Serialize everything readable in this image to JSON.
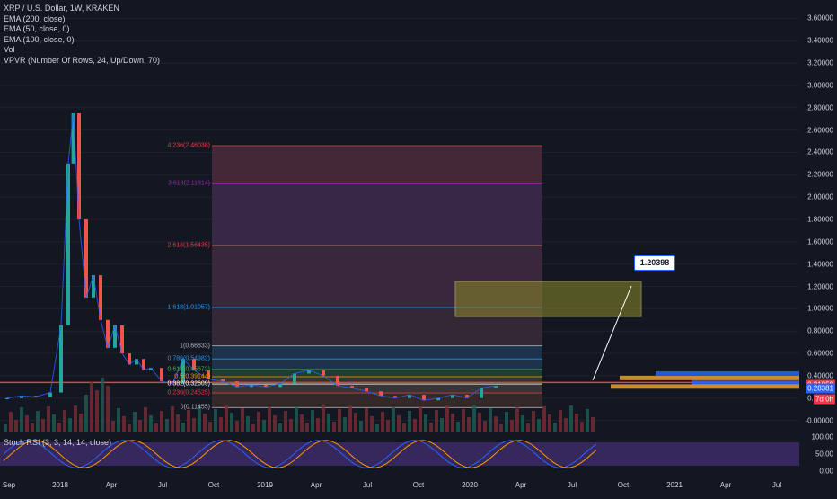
{
  "chart_data": {
    "type": "candlestick",
    "title": "XRP / U.S. Dollar, 1W, KRAKEN",
    "indicators": [
      "EMA (200, close)",
      "EMA (50, close, 0)",
      "EMA (100, close, 0)",
      "Vol",
      "VPVR (Number Of Rows, 24, Up/Down, 70)"
    ],
    "sub_indicator": "Stoch RSI (3, 3, 14, 14, close)",
    "x_ticks": [
      "Sep",
      "2018",
      "Apr",
      "Jul",
      "Oct",
      "2019",
      "Apr",
      "Jul",
      "Oct",
      "2020",
      "Apr",
      "Jul",
      "Oct",
      "2021",
      "Apr",
      "Jul"
    ],
    "y_ticks": [
      "3.60000",
      "3.40000",
      "3.20000",
      "3.00000",
      "2.80000",
      "2.60000",
      "2.40000",
      "2.20000",
      "2.00000",
      "1.80000",
      "1.60000",
      "1.40000",
      "1.20000",
      "1.00000",
      "0.80000",
      "0.60000",
      "0.40000",
      "0.20000",
      "-0.00000"
    ],
    "ylim": [
      -0.1,
      3.7
    ],
    "rsi_ticks": [
      "100.00",
      "50.00",
      "0.00"
    ],
    "price_tags": [
      {
        "label": "0.31859",
        "value": 0.31859,
        "color": "#f23645"
      },
      {
        "label": "0.28381",
        "value": 0.28381,
        "color": "#2962ff"
      },
      {
        "label": "7d 0h",
        "value": 0.19,
        "color": "#f23645"
      }
    ],
    "fib_levels": [
      {
        "label": "4.236(2.46038)",
        "value": 2.46038,
        "color": "#f23645"
      },
      {
        "label": "3.618(2.11814)",
        "value": 2.11814,
        "color": "#9c27b0"
      },
      {
        "label": "2.618(1.56435)",
        "value": 1.56435,
        "color": "#f23645"
      },
      {
        "label": "1.618(1.01057)",
        "value": 1.01057,
        "color": "#2196f3"
      },
      {
        "label": "1(0.66833)",
        "value": 0.66833,
        "color": "#b2b5be"
      },
      {
        "label": "0.786(0.54982)",
        "value": 0.54982,
        "color": "#2196f3"
      },
      {
        "label": "0.618(0.45672)",
        "value": 0.45672,
        "color": "#4caf50"
      },
      {
        "label": "0.5(0.39144)",
        "value": 0.39144,
        "color": "#ff9800"
      },
      {
        "label": "0.382(0.32609)",
        "value": 0.32609,
        "color": "#ffffff"
      },
      {
        "label": "0.236(0.24525)",
        "value": 0.24525,
        "color": "#f23645"
      },
      {
        "label": "0(0.11455)",
        "value": 0.11455,
        "color": "#b2b5be"
      }
    ],
    "target_label": "1.20398",
    "target_value": 1.20398,
    "price_series": [
      {
        "t": 0,
        "o": 0.19,
        "c": 0.2
      },
      {
        "t": 0.02,
        "o": 0.2,
        "c": 0.22
      },
      {
        "t": 0.04,
        "o": 0.22,
        "c": 0.21
      },
      {
        "t": 0.06,
        "o": 0.21,
        "c": 0.25
      },
      {
        "t": 0.075,
        "o": 0.25,
        "c": 0.85
      },
      {
        "t": 0.085,
        "o": 0.85,
        "c": 2.3
      },
      {
        "t": 0.092,
        "o": 2.3,
        "c": 2.75
      },
      {
        "t": 0.1,
        "o": 2.75,
        "c": 1.8
      },
      {
        "t": 0.11,
        "o": 1.8,
        "c": 1.1
      },
      {
        "t": 0.12,
        "o": 1.1,
        "c": 1.3
      },
      {
        "t": 0.13,
        "o": 1.3,
        "c": 0.9
      },
      {
        "t": 0.14,
        "o": 0.9,
        "c": 0.65
      },
      {
        "t": 0.15,
        "o": 0.65,
        "c": 0.85
      },
      {
        "t": 0.16,
        "o": 0.85,
        "c": 0.6
      },
      {
        "t": 0.17,
        "o": 0.6,
        "c": 0.5
      },
      {
        "t": 0.18,
        "o": 0.5,
        "c": 0.55
      },
      {
        "t": 0.19,
        "o": 0.55,
        "c": 0.45
      },
      {
        "t": 0.2,
        "o": 0.45,
        "c": 0.47
      },
      {
        "t": 0.215,
        "o": 0.47,
        "c": 0.35
      },
      {
        "t": 0.23,
        "o": 0.35,
        "c": 0.33
      },
      {
        "t": 0.245,
        "o": 0.33,
        "c": 0.55
      },
      {
        "t": 0.26,
        "o": 0.55,
        "c": 0.45
      },
      {
        "t": 0.28,
        "o": 0.45,
        "c": 0.37
      },
      {
        "t": 0.3,
        "o": 0.37,
        "c": 0.35
      },
      {
        "t": 0.32,
        "o": 0.35,
        "c": 0.3
      },
      {
        "t": 0.34,
        "o": 0.3,
        "c": 0.32
      },
      {
        "t": 0.36,
        "o": 0.32,
        "c": 0.3
      },
      {
        "t": 0.38,
        "o": 0.3,
        "c": 0.33
      },
      {
        "t": 0.4,
        "o": 0.33,
        "c": 0.42
      },
      {
        "t": 0.42,
        "o": 0.42,
        "c": 0.45
      },
      {
        "t": 0.44,
        "o": 0.45,
        "c": 0.4
      },
      {
        "t": 0.46,
        "o": 0.4,
        "c": 0.31
      },
      {
        "t": 0.48,
        "o": 0.31,
        "c": 0.29
      },
      {
        "t": 0.5,
        "o": 0.29,
        "c": 0.26
      },
      {
        "t": 0.52,
        "o": 0.26,
        "c": 0.22
      },
      {
        "t": 0.54,
        "o": 0.22,
        "c": 0.2
      },
      {
        "t": 0.56,
        "o": 0.2,
        "c": 0.23
      },
      {
        "t": 0.58,
        "o": 0.23,
        "c": 0.18
      },
      {
        "t": 0.6,
        "o": 0.18,
        "c": 0.2
      },
      {
        "t": 0.62,
        "o": 0.2,
        "c": 0.23
      },
      {
        "t": 0.64,
        "o": 0.23,
        "c": 0.2
      },
      {
        "t": 0.66,
        "o": 0.2,
        "c": 0.29
      },
      {
        "t": 0.68,
        "o": 0.29,
        "c": 0.31
      }
    ]
  }
}
